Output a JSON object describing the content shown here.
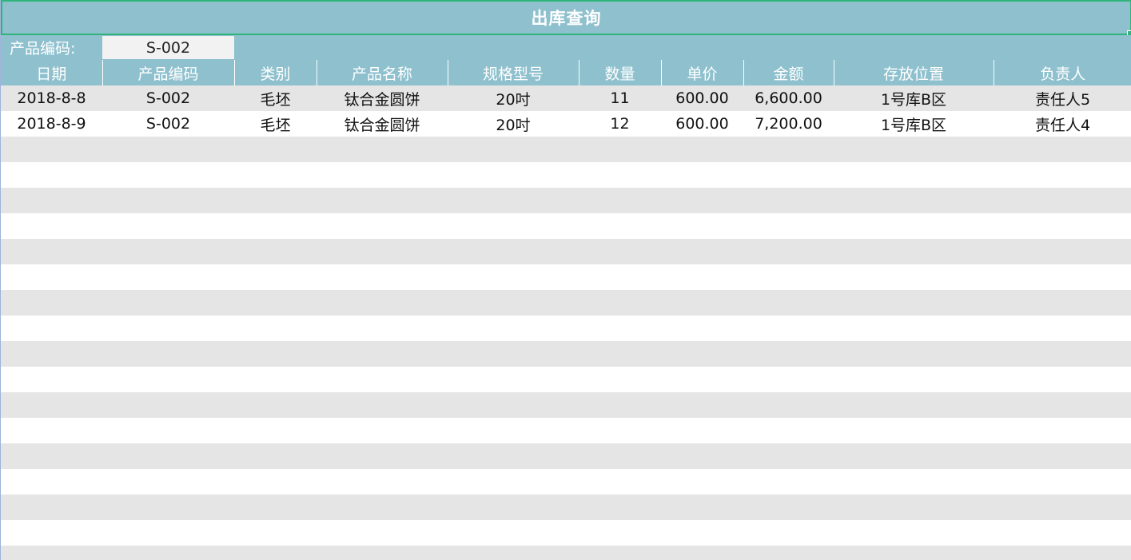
{
  "title": "出库查询",
  "query": {
    "label": "产品编码:",
    "value": "S-002"
  },
  "columns": [
    "日期",
    "产品编码",
    "类别",
    "产品名称",
    "规格型号",
    "数量",
    "单价",
    "金额",
    "存放位置",
    "负责人"
  ],
  "rows": [
    [
      "2018-8-8",
      "S-002",
      "毛坯",
      "钛合金圆饼",
      "20吋",
      "11",
      "600.00",
      "6,600.00",
      "1号库B区",
      "责任人5"
    ],
    [
      "2018-8-9",
      "S-002",
      "毛坯",
      "钛合金圆饼",
      "20吋",
      "12",
      "600.00",
      "7,200.00",
      "1号库B区",
      "责任人4"
    ]
  ],
  "colors": {
    "header_bg": "#8ec0ce",
    "selection_border": "#2fb57a",
    "band_gray": "#e5e5e5"
  }
}
